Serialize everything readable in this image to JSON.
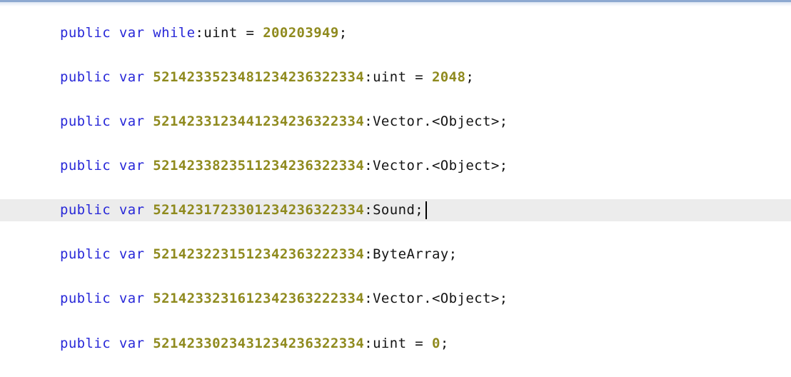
{
  "editor": {
    "lines": [
      {
        "kw1": "public",
        "kw2": "var",
        "name": "while",
        "rest": ":uint = ",
        "value": "200203949",
        "end": ";"
      },
      {
        "kw1": "public",
        "kw2": "var",
        "name": "5214233523481234236322334",
        "rest": ":uint = ",
        "value": "2048",
        "end": ";"
      },
      {
        "kw1": "public",
        "kw2": "var",
        "name": "5214233123441234236322334",
        "rest": ":Vector.<Object>;",
        "value": "",
        "end": ""
      },
      {
        "kw1": "public",
        "kw2": "var",
        "name": "5214233823511234236322334",
        "rest": ":Vector.<Object>;",
        "value": "",
        "end": ""
      },
      {
        "kw1": "public",
        "kw2": "var",
        "name": "5214231723301234236322334",
        "rest": ":Sound;",
        "value": "",
        "end": ""
      },
      {
        "kw1": "public",
        "kw2": "var",
        "name": "5214232231512342363222334",
        "rest": ":ByteArray;",
        "value": "",
        "end": ""
      },
      {
        "kw1": "public",
        "kw2": "var",
        "name": "5214233231612342363222334",
        "rest": ":Vector.<Object>;",
        "value": "",
        "end": ""
      },
      {
        "kw1": "public",
        "kw2": "var",
        "name": "5214233023431234236322334",
        "rest": ":uint = ",
        "value": "0",
        "end": ";"
      }
    ]
  }
}
